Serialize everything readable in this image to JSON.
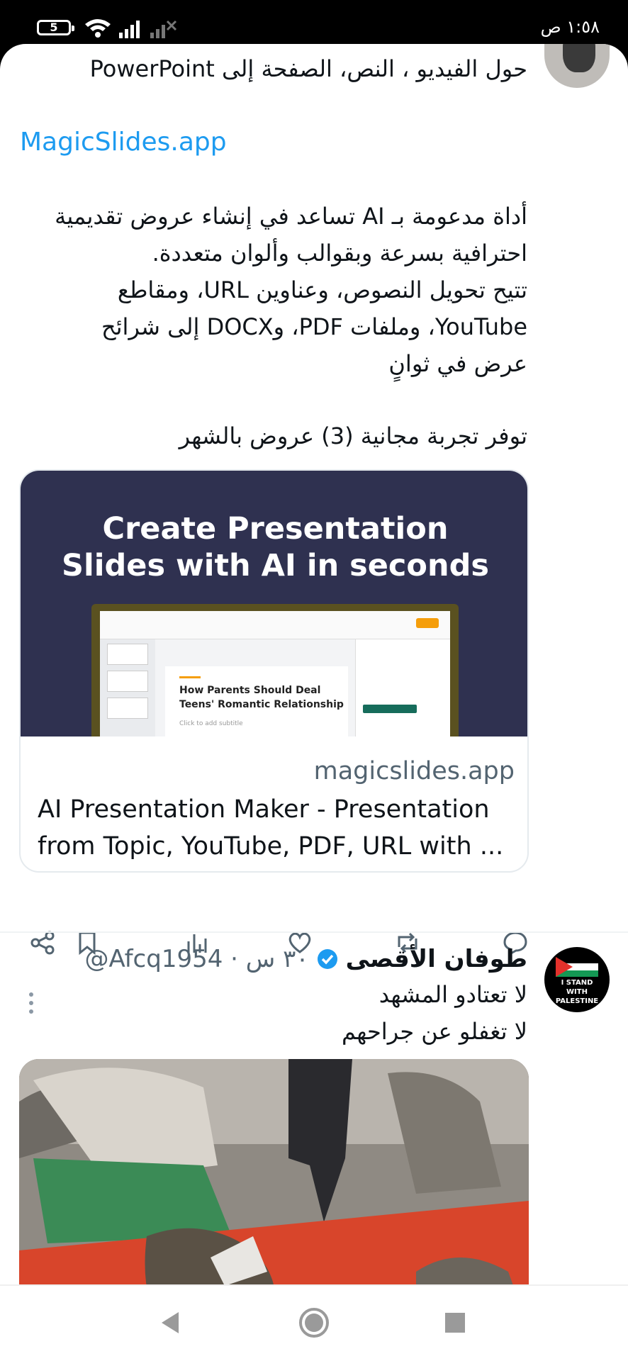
{
  "status_bar": {
    "battery": "5",
    "time": "١:٥٨ ص"
  },
  "tweet1": {
    "line_top": "حول الفيديو ، النص، الصفحة إلى PowerPoint",
    "link": "MagicSlides.app",
    "para": [
      "أداة مدعومة بـ AI تساعد في إنشاء عروض تقديمية",
      "احترافية بسرعة وبقوالب وألوان متعددة.",
      "تتيح تحويل النصوص، وعناوين URL، ومقاطع",
      "YouTube، وملفات PDF، وDOCX إلى شرائح",
      "عرض في ثوانٍ"
    ],
    "offer": "توفر تجربة مجانية (3) عروض بالشهر",
    "card": {
      "headline_1": "Create Presentation",
      "headline_2": "Slides with AI in seconds",
      "slide_title_1": "How Parents Should Deal",
      "slide_title_2": "Teens' Romantic Relationship",
      "slide_subtitle": "Click to add subtitle",
      "domain": "magicslides.app",
      "title_1": "AI Presentation Maker - Presentation",
      "title_2": "from Topic, YouTube, PDF, URL with ..."
    },
    "actions": [
      "share-icon",
      "bookmark-icon",
      "views-icon",
      "like-icon",
      "retweet-icon",
      "reply-icon"
    ]
  },
  "tweet2": {
    "author": "طوفان الأقصى",
    "handle": "@Afcq1954 · ٣٠ س",
    "lines": [
      "لا تعتادو المشهد",
      "لا تغفلو عن جراحهم"
    ],
    "avatar_text": [
      "I STAND",
      "WITH",
      "PALESTINE"
    ]
  },
  "colors": {
    "accent": "#1d9bf0",
    "text": "#0f1419",
    "secondary": "#536471",
    "card_bg": "#2f3150"
  }
}
